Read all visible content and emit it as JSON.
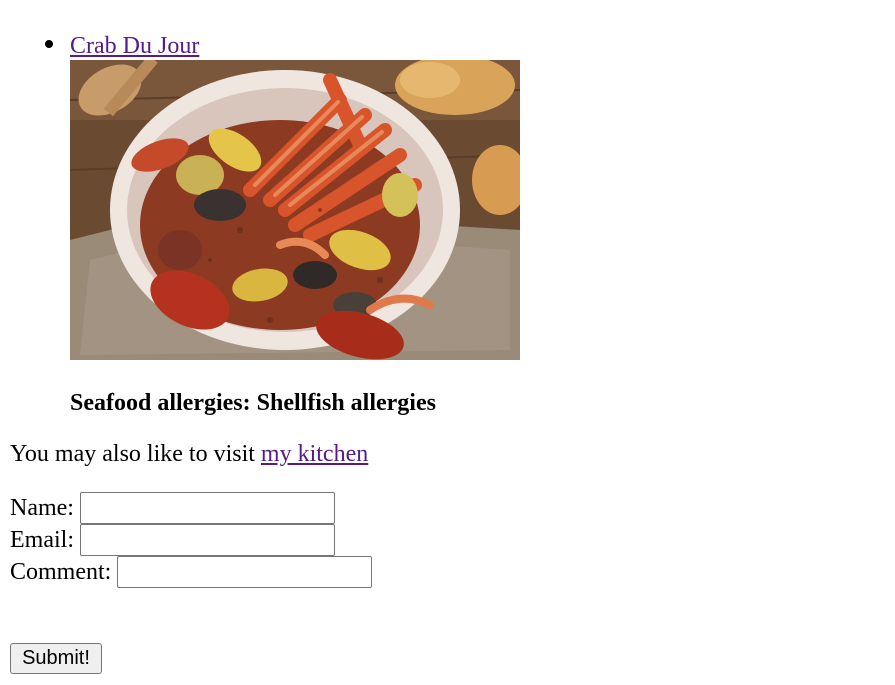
{
  "list": {
    "item_label": "Crab Du Jour"
  },
  "photo": {
    "subject": "seafood boil: crab legs, crawfish, clams, shrimp, corn and potatoes in a plastic bag on a burlap cloth"
  },
  "allergy": {
    "text": "Seafood allergies: Shellfish allergies"
  },
  "visit": {
    "prefix": "You may also like to visit ",
    "link_label": "my kitchen"
  },
  "form": {
    "name_label": "Name:",
    "name_value": "",
    "email_label": "Email:",
    "email_value": "",
    "comment_label": "Comment:",
    "comment_value": "",
    "submit_label": "Submit!"
  },
  "colors": {
    "visited_link": "#551a8b",
    "button_bg": "#efefef",
    "input_border": "#767676"
  }
}
